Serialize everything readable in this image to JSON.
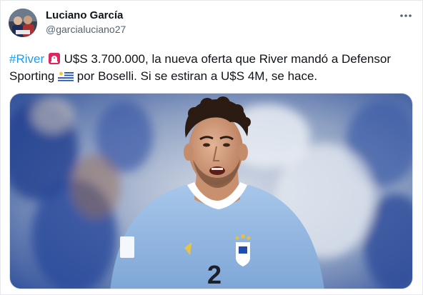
{
  "author": {
    "name": "Luciano García",
    "handle": "@garcialuciano27"
  },
  "tweet": {
    "line1_hashtag": "#River",
    "line1_text": " U$S 3.700.000, la nueva oferta que River mandó a Defensor",
    "line2_start": "Sporting ",
    "line2_end": " por Boselli. Si se estiran a U$S 4M, se hace."
  },
  "media": {
    "shirt_number": "2"
  },
  "icons": {
    "more": "more-dots-icon",
    "siren": "police-light-emoji",
    "flag": "uruguay-flag-emoji"
  },
  "colors": {
    "accent": "#1d9bf0",
    "text": "#0f1419",
    "muted": "#536471",
    "shirt": "#8fb5e0"
  }
}
